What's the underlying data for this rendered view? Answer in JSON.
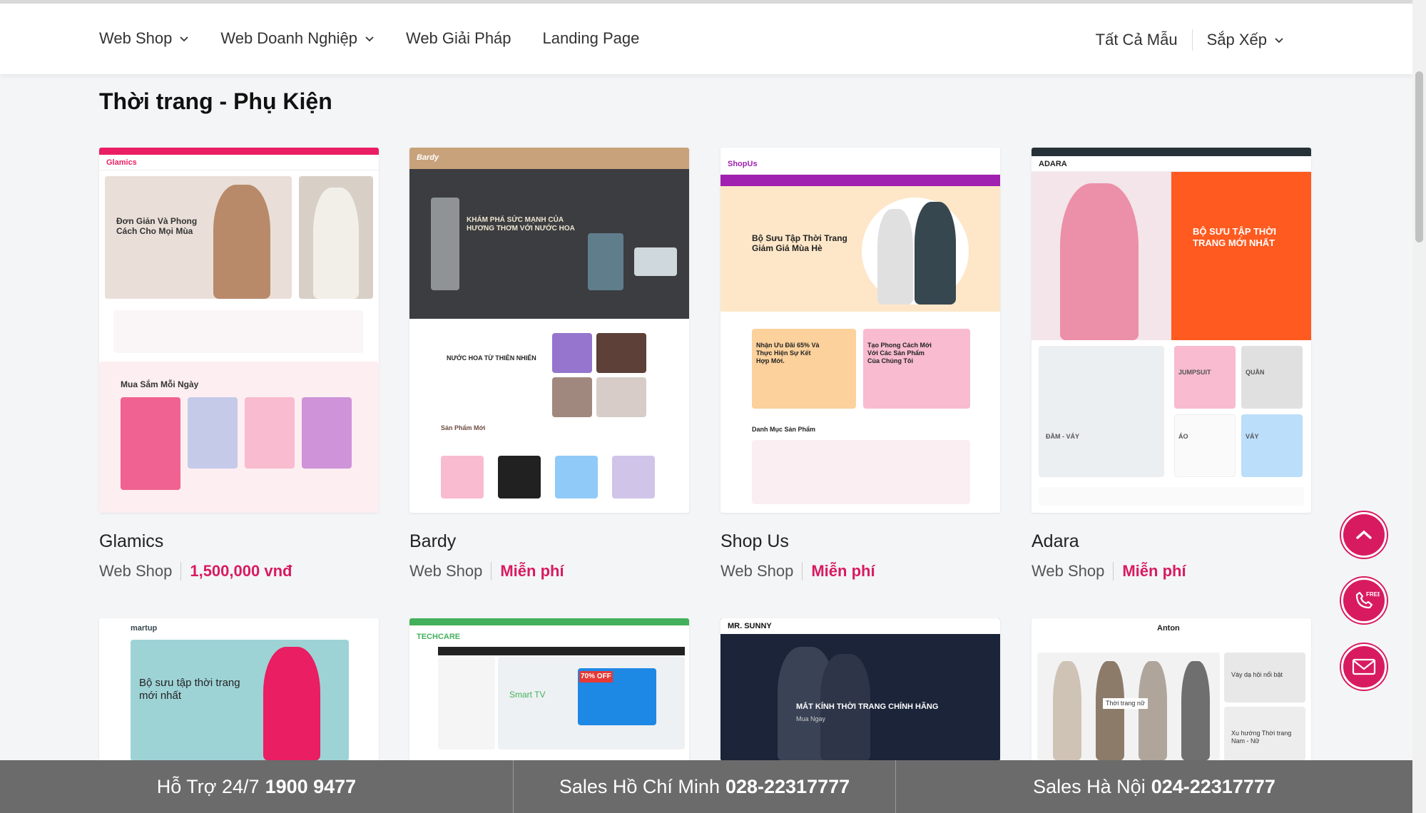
{
  "nav": {
    "items": [
      {
        "label": "Web Shop",
        "has_dropdown": true
      },
      {
        "label": "Web Doanh Nghiệp",
        "has_dropdown": true
      },
      {
        "label": "Web Giải Pháp",
        "has_dropdown": false
      },
      {
        "label": "Landing Page",
        "has_dropdown": false
      }
    ],
    "right": {
      "all_templates": "Tất Cả Mẫu",
      "sort": "Sắp Xếp"
    }
  },
  "section": {
    "title": "Thời trang - Phụ Kiện"
  },
  "cards": [
    {
      "name": "Glamics",
      "category": "Web Shop",
      "price": "1,500,000 vnđ",
      "preview": {
        "logo": "Glamics",
        "hero_text": "Đơn Giản Và Phong Cách Cho Mọi Mùa",
        "section_text": "Mua Sắm Mỗi Ngày",
        "accent": "#e91e63"
      }
    },
    {
      "name": "Bardy",
      "category": "Web Shop",
      "price": "Miễn phí",
      "preview": {
        "logo": "Bardy",
        "hero_text": "KHÁM PHÁ SỨC MẠNH CỦA HƯƠNG THƠM VỚI NƯỚC HOA",
        "section_text": "NƯỚC HOA TỪ THIÊN NHIÊN",
        "section2_text": "Sản Phẩm Mới",
        "accent": "#c8a27a"
      }
    },
    {
      "name": "Shop Us",
      "category": "Web Shop",
      "price": "Miễn phí",
      "preview": {
        "logo": "ShopUs",
        "hero_text": "Bộ Sưu Tập Thời Trang Giảm Giá Mùa Hè",
        "promo1": "Nhận Ưu Đãi 65% Và Thực Hiện Sự Kết Hợp Mới.",
        "promo2": "Tạo Phong Cách Mới Với Các Sản Phẩm Của Chúng Tôi",
        "section_text": "Danh Mục Sản Phẩm",
        "accent": "#a020b0"
      }
    },
    {
      "name": "Adara",
      "category": "Web Shop",
      "price": "Miễn phí",
      "preview": {
        "logo": "ADARA",
        "hero_text": "BỘ SƯU TẬP THỜI TRANG MỚI NHẤT",
        "tiles": [
          "ĐẦM - VÁY",
          "JUMPSUIT",
          "QUẦN",
          "ÁO",
          "VÁY"
        ],
        "accent": "#ff5a1f"
      }
    }
  ],
  "cards_row2": [
    {
      "logo": "martup",
      "hero_text": "Bộ sưu tập thời trang mới nhất",
      "accent": "#9ed3d6"
    },
    {
      "logo": "TECHCARE",
      "hero_text": "Smart TV",
      "badge": "70% OFF",
      "accent": "#43b05c"
    },
    {
      "logo": "MR. SUNNY",
      "hero_text": "MẮT KÍNH THỜI TRANG CHÍNH HÃNG",
      "sub_text": "Mua Ngay",
      "accent": "#1b2438"
    },
    {
      "logo": "Anton",
      "hero_text": "Thời trang nữ",
      "side1": "Váy dạ hội nổi bật",
      "side2": "Xu hướng Thời trang Nam - Nữ",
      "accent": "#ffffff"
    }
  ],
  "floating": {
    "scroll_top": "chevron-up-icon",
    "phone": "phone-free-icon",
    "mail": "mail-icon",
    "phone_badge": "FREE"
  },
  "bottom_bar": {
    "support_label": "Hỗ Trợ 24/7",
    "support_phone": "1900 9477",
    "hcm_label": "Sales Hồ Chí Minh",
    "hcm_phone": "028-22317777",
    "hn_label": "Sales Hà Nội",
    "hn_phone": "024-22317777"
  },
  "colors": {
    "accent": "#d81b60",
    "bottom_bar": "#6b6b6b"
  }
}
